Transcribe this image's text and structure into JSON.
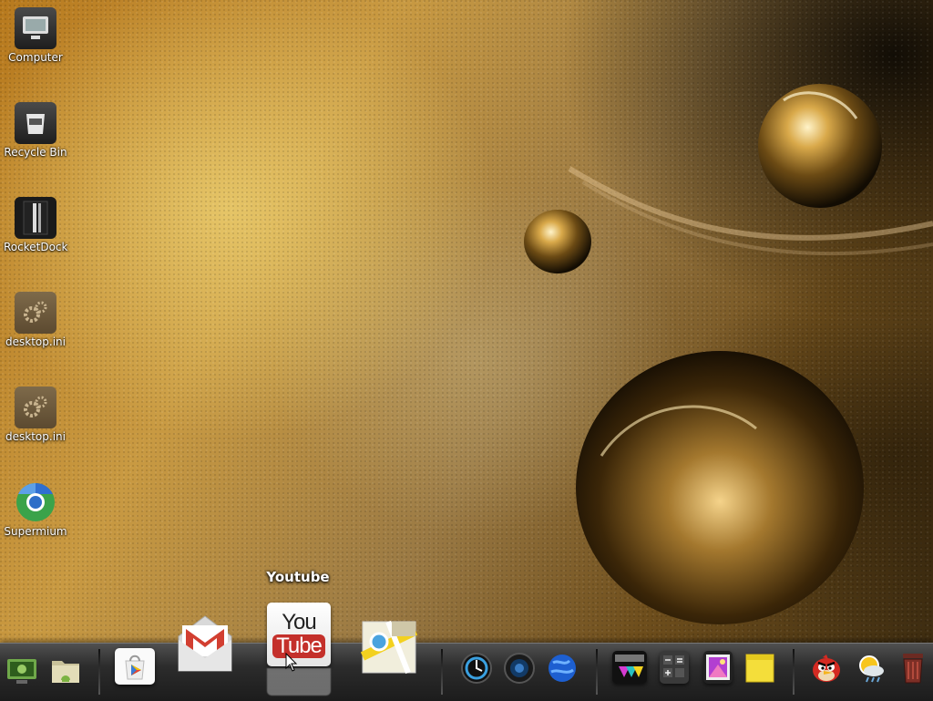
{
  "desktop_icons": [
    {
      "label": "Computer",
      "icon": "computer-icon"
    },
    {
      "label": "Recycle Bin",
      "icon": "recycle-bin-icon"
    },
    {
      "label": "RocketDock",
      "icon": "rocketdock-icon"
    },
    {
      "label": "desktop.ini",
      "icon": "settings-file-icon"
    },
    {
      "label": "desktop.ini",
      "icon": "settings-file-icon"
    },
    {
      "label": "Supermium",
      "icon": "browser-icon"
    }
  ],
  "dock": {
    "tooltip": "Youtube",
    "youtube_logo": {
      "top": "You",
      "bottom": "Tube"
    },
    "gmail_logo": "M",
    "items": [
      {
        "name": "android-desktop",
        "icon": "android-desktop-icon"
      },
      {
        "name": "android-files",
        "icon": "android-folder-icon"
      },
      {
        "name": "play-store",
        "icon": "play-store-icon"
      },
      {
        "name": "gmail",
        "icon": "gmail-icon"
      },
      {
        "name": "youtube",
        "icon": "youtube-icon"
      },
      {
        "name": "maps",
        "icon": "maps-icon"
      },
      {
        "name": "clock",
        "icon": "clock-icon"
      },
      {
        "name": "speaker",
        "icon": "speaker-icon"
      },
      {
        "name": "browser",
        "icon": "globe-icon"
      },
      {
        "name": "themes",
        "icon": "themes-icon"
      },
      {
        "name": "calculator",
        "icon": "calculator-icon"
      },
      {
        "name": "gallery",
        "icon": "gallery-icon"
      },
      {
        "name": "notes",
        "icon": "sticky-note-icon"
      },
      {
        "name": "angry-birds",
        "icon": "angry-birds-icon"
      },
      {
        "name": "weather",
        "icon": "weather-icon"
      },
      {
        "name": "recycle",
        "icon": "dock-trash-icon"
      }
    ]
  },
  "colors": {
    "youtube_red": "#c4302b",
    "gmail_red": "#d23f31",
    "dock_bg": "#2c2c2c"
  }
}
